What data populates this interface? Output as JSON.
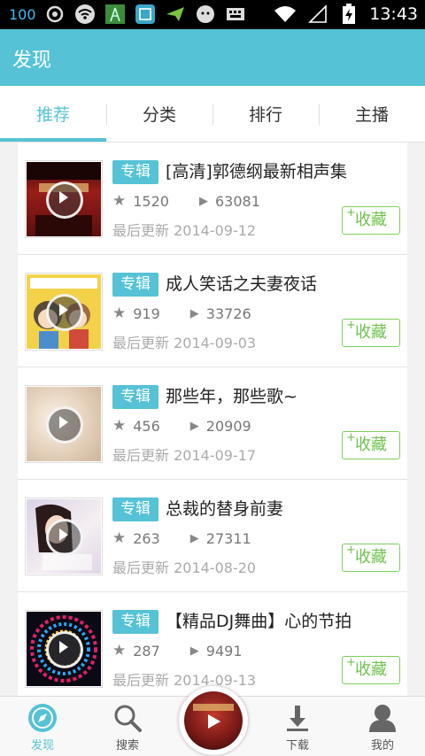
{
  "status_bar": {
    "battery_level": "100",
    "time": "13:43"
  },
  "app_bar": {
    "title": "发现"
  },
  "tabs": [
    {
      "label": "推荐",
      "active": true
    },
    {
      "label": "分类",
      "active": false
    },
    {
      "label": "排行",
      "active": false
    },
    {
      "label": "主播",
      "active": false
    }
  ],
  "albums": [
    {
      "badge": "专辑",
      "title": "[高清]郭德纲最新相声集",
      "likes": "1520",
      "plays": "63081",
      "updated": "最后更新 2014-09-12",
      "fav_label": "收藏"
    },
    {
      "badge": "专辑",
      "title": "成人笑话之夫妻夜话",
      "likes": "919",
      "plays": "33726",
      "updated": "最后更新 2014-09-03",
      "fav_label": "收藏"
    },
    {
      "badge": "专辑",
      "title": "那些年，那些歌~",
      "likes": "456",
      "plays": "20909",
      "updated": "最后更新 2014-09-17",
      "fav_label": "收藏"
    },
    {
      "badge": "专辑",
      "title": "总裁的替身前妻",
      "likes": "263",
      "plays": "27311",
      "updated": "最后更新 2014-08-20",
      "fav_label": "收藏"
    },
    {
      "badge": "专辑",
      "title": "【精品DJ舞曲】心的节拍",
      "likes": "287",
      "plays": "9491",
      "updated": "最后更新 2014-09-13",
      "fav_label": "收藏"
    }
  ],
  "bottom_nav": [
    {
      "label": "发现",
      "icon": "compass-icon",
      "active": true
    },
    {
      "label": "搜索",
      "icon": "search-icon",
      "active": false
    },
    {
      "label": "下载",
      "icon": "download-icon",
      "active": false
    },
    {
      "label": "我的",
      "icon": "user-icon",
      "active": false
    }
  ],
  "colors": {
    "accent": "#55c2d6",
    "fav_green": "#6ec24e",
    "status_bar": "#000000"
  }
}
